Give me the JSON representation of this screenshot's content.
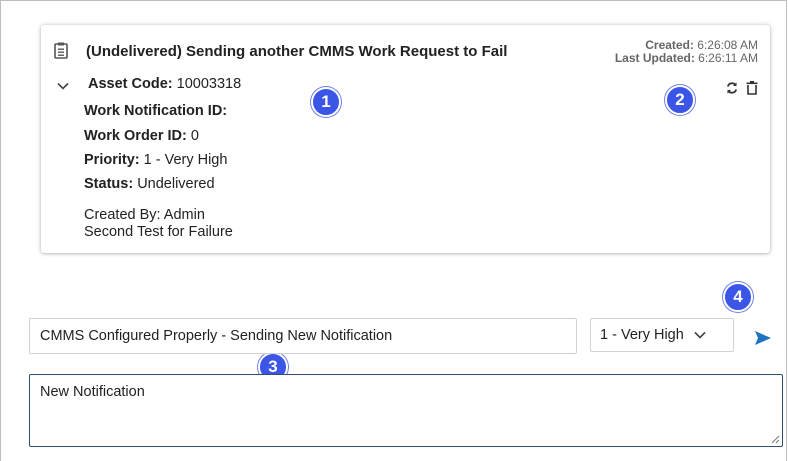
{
  "card": {
    "title": "(Undelivered) Sending another CMMS Work Request to Fail",
    "created_label": "Created:",
    "created_value": "6:26:08 AM",
    "updated_label": "Last Updated:",
    "updated_value": "6:26:11 AM",
    "asset_code_label": "Asset Code:",
    "asset_code_value": "10003318",
    "work_notification_label": "Work Notification ID:",
    "work_notification_value": "",
    "work_order_label": "Work Order ID:",
    "work_order_value": "0",
    "priority_label": "Priority:",
    "priority_value": "1 - Very High",
    "status_label": "Status:",
    "status_value": "Undelivered",
    "created_by": "Created By: Admin",
    "description": "Second Test for Failure"
  },
  "composer": {
    "subject_value": "CMMS Configured Properly - Sending New Notification",
    "priority_selected": "1 - Very High",
    "body_value": "New Notification"
  },
  "callouts": [
    "1",
    "2",
    "3",
    "4"
  ],
  "colors": {
    "callout": "#3b55e6",
    "send_icon": "#1e73be",
    "textarea_border": "#2e4f73"
  },
  "icons": [
    "clipboard-icon",
    "chevron-down-icon",
    "refresh-icon",
    "trash-icon",
    "send-icon",
    "resize-grip-icon"
  ]
}
